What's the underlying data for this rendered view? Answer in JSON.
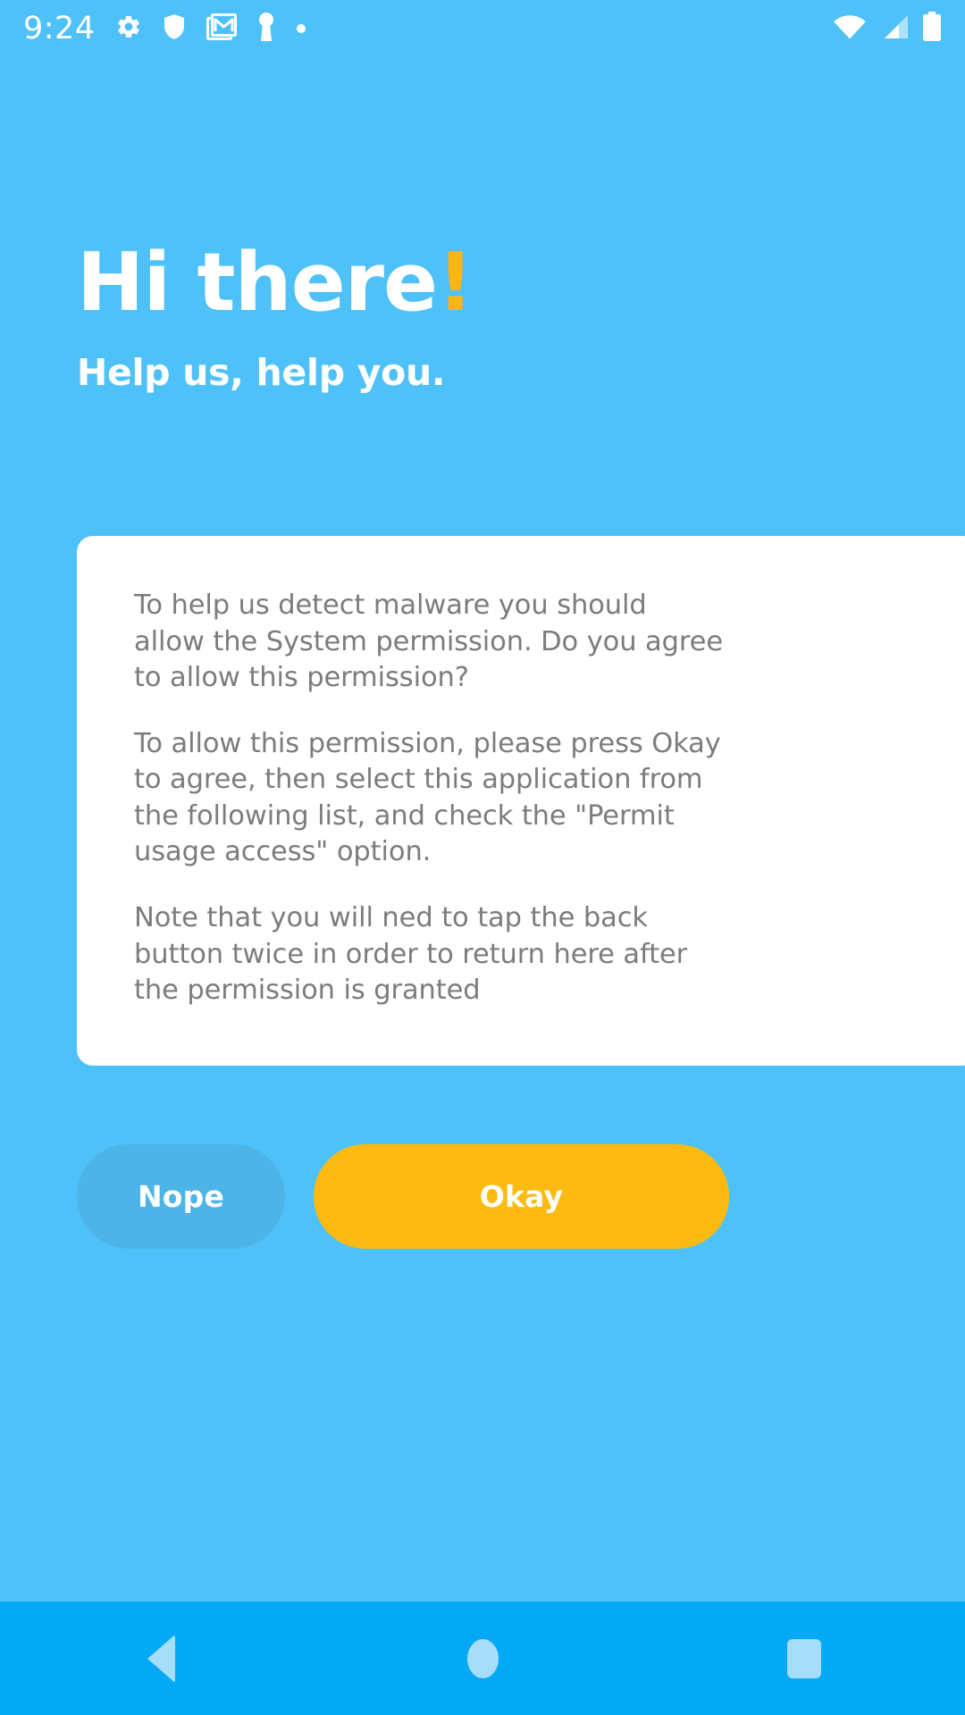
{
  "status_bar": {
    "clock": "9:24",
    "left_icons": [
      "gear-icon",
      "shield-icon",
      "gmail-icon",
      "key-icon",
      "dot-icon"
    ],
    "right_icons": [
      "wifi-icon",
      "cellular-signal-icon",
      "battery-icon"
    ]
  },
  "hero": {
    "title": "Hi there",
    "exclamation": "!",
    "subtitle": "Help us, help you."
  },
  "card": {
    "paragraphs": [
      "To help us detect malware you should allow the System permission. Do you agree to allow this permission?",
      "To allow this permission, please press Okay to agree, then select this application from the following list, and check the \"Permit usage access\" option.",
      "Note that you will ned to tap the back button twice in order to return here after the permission is granted"
    ]
  },
  "buttons": {
    "decline_label": "Nope",
    "accept_label": "Okay"
  },
  "nav_bar": {
    "back_label": "Back",
    "home_label": "Home",
    "recents_label": "Recents"
  },
  "colors": {
    "background": "#4FC1F9",
    "card": "#FFFFFF",
    "accent_amber": "#FDBA12",
    "exclamation_amber": "#FBB517",
    "decline_blue": "#4DB4E8",
    "nav_bar": "#03A9F4",
    "nav_icon": "#A6DDF8",
    "body_text": "#7C7C7C"
  }
}
